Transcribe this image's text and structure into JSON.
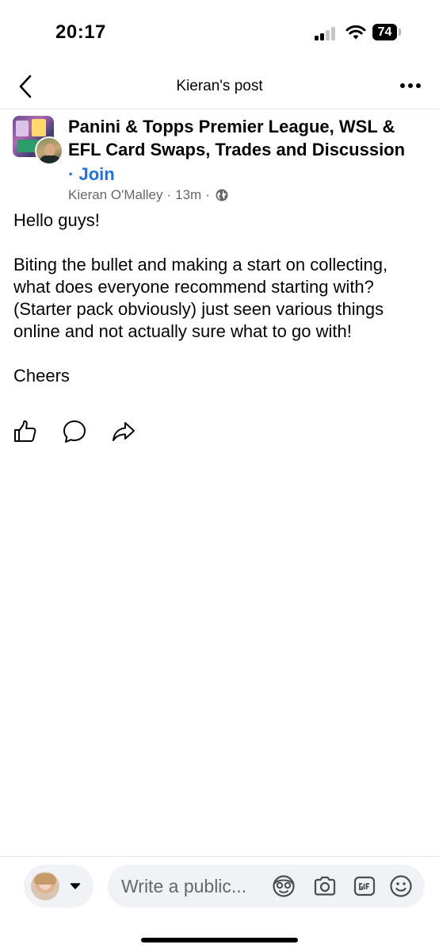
{
  "status_bar": {
    "time": "20:17",
    "battery": "74",
    "icons": [
      "cellular-signal-icon",
      "wifi-icon",
      "battery-icon"
    ]
  },
  "header": {
    "title": "Kieran's post",
    "back_icon": "chevron-left-icon",
    "more_icon": "ellipsis-icon"
  },
  "post": {
    "group_name": "Panini & Topps Premier League, WSL & EFL Card Swaps, Trades and Discussion",
    "join_separator": "·",
    "join_label": "Join",
    "author": "Kieran O'Malley",
    "meta_separator": "·",
    "time_ago": "13m",
    "meta_separator_2": "·",
    "audience_icon": "globe-icon",
    "body": {
      "greeting": "Hello guys!",
      "paragraph": "Biting the bullet and making a start on collecting, what does everyone recommend starting with? (Starter pack obviously) just seen various things online and not actually sure what to go with!",
      "signoff": "Cheers"
    },
    "actions": [
      "like-icon",
      "comment-icon",
      "share-icon"
    ]
  },
  "composer": {
    "placeholder": "Write a public...",
    "icons": [
      "avatar-sticker-icon",
      "camera-icon",
      "gif-icon",
      "emoji-icon"
    ]
  },
  "colors": {
    "link": "#1b74e4",
    "secondary_text": "#65676b",
    "input_bg": "#f0f2f5"
  }
}
